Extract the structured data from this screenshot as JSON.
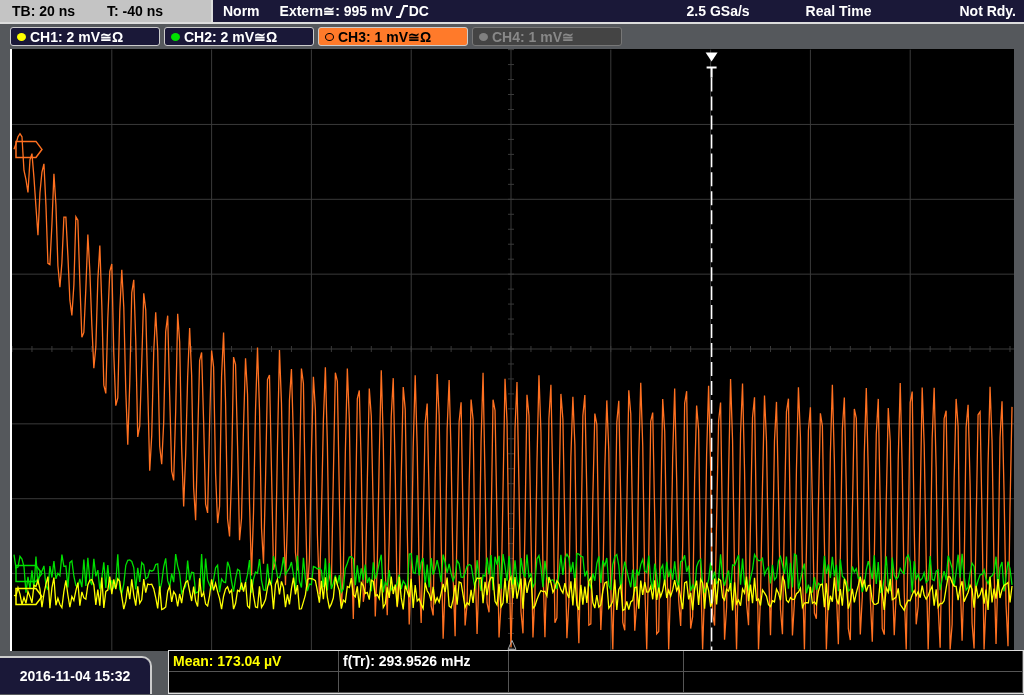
{
  "top_bar": {
    "timebase": "TB: 20 ns",
    "trigger_time": "T: -40 ns",
    "mode": "Norm",
    "trigger_source": "Extern≅: 995 mV",
    "coupling": "DC",
    "sample_rate": "2.5 GSa/s",
    "acquisition": "Real Time",
    "status": "Not Rdy."
  },
  "channels": [
    {
      "label": "CH1: 2 mV≅Ω",
      "color": "#ffff00",
      "selected": false,
      "disabled": false
    },
    {
      "label": "CH2: 2 mV≅Ω",
      "color": "#00e000",
      "selected": false,
      "disabled": false
    },
    {
      "label": "CH3: 1 mV≅Ω",
      "color": "#ff7020",
      "selected": true,
      "disabled": false
    },
    {
      "label": "CH4: 1 mV≅",
      "color": "#808080",
      "selected": false,
      "disabled": true
    }
  ],
  "date": "2016-11-04 15:32",
  "measurements": [
    {
      "label": "Mean: 173.04 µV",
      "color": "#ffff00"
    },
    {
      "label": "f(Tr): 293.9526 mHz",
      "color": "#ffffff"
    }
  ]
}
